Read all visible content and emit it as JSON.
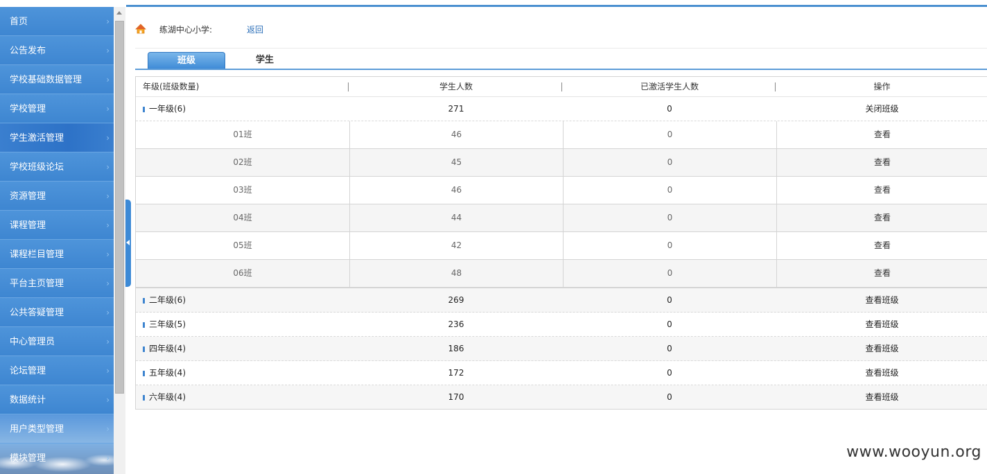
{
  "sidebar": {
    "items": [
      {
        "label": "首页"
      },
      {
        "label": "公告发布"
      },
      {
        "label": "学校基础数据管理"
      },
      {
        "label": "学校管理"
      },
      {
        "label": "学生激活管理"
      },
      {
        "label": "学校班级论坛"
      },
      {
        "label": "资源管理"
      },
      {
        "label": "课程管理"
      },
      {
        "label": "课程栏目管理"
      },
      {
        "label": "平台主页管理"
      },
      {
        "label": "公共答疑管理"
      },
      {
        "label": "中心管理员"
      },
      {
        "label": "论坛管理"
      },
      {
        "label": "数据统计"
      },
      {
        "label": "用户类型管理"
      },
      {
        "label": "模块管理"
      }
    ],
    "chevron": "›"
  },
  "breadcrumb": {
    "school": "练湖中心小学:",
    "back": "返回"
  },
  "tabs": [
    {
      "label": "班级",
      "active": true
    },
    {
      "label": "学生",
      "active": false
    }
  ],
  "table": {
    "headers": [
      "年级(班级数量)",
      "学生人数",
      "已激活学生人数",
      "操作"
    ],
    "grades": [
      {
        "name": "一年级(6)",
        "students": "271",
        "activated": "0",
        "action": "关闭班级",
        "classes": [
          {
            "name": "01班",
            "students": "46",
            "activated": "0",
            "action": "查看"
          },
          {
            "name": "02班",
            "students": "45",
            "activated": "0",
            "action": "查看"
          },
          {
            "name": "03班",
            "students": "46",
            "activated": "0",
            "action": "查看"
          },
          {
            "name": "04班",
            "students": "44",
            "activated": "0",
            "action": "查看"
          },
          {
            "name": "05班",
            "students": "42",
            "activated": "0",
            "action": "查看"
          },
          {
            "name": "06班",
            "students": "48",
            "activated": "0",
            "action": "查看"
          }
        ]
      },
      {
        "name": "二年级(6)",
        "students": "269",
        "activated": "0",
        "action": "查看班级"
      },
      {
        "name": "三年级(5)",
        "students": "236",
        "activated": "0",
        "action": "查看班级"
      },
      {
        "name": "四年级(4)",
        "students": "186",
        "activated": "0",
        "action": "查看班级"
      },
      {
        "name": "五年级(4)",
        "students": "172",
        "activated": "0",
        "action": "查看班级"
      },
      {
        "name": "六年级(4)",
        "students": "170",
        "activated": "0",
        "action": "查看班级"
      }
    ]
  },
  "watermark": "www.wooyun.org",
  "colors": {
    "sidebar": "#3d84cf",
    "accent": "#3d8ad6",
    "link": "#2a6eb8"
  }
}
